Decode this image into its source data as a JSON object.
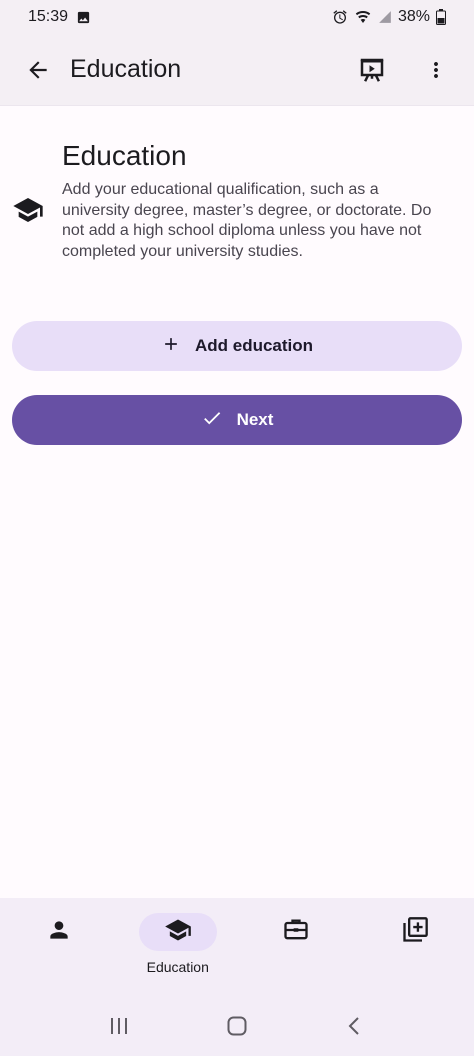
{
  "status_bar": {
    "time": "15:39",
    "battery": "38%"
  },
  "app_bar": {
    "title": "Education",
    "icons": [
      "arrow-back-icon",
      "presentation-icon",
      "more-vert-icon"
    ]
  },
  "intro": {
    "icon": "school-icon",
    "title": "Education",
    "description": "Add your educational qualification, such as a university degree, master’s degree, or doctorate. Do not add a high school diploma unless you have not completed your university studies."
  },
  "buttons": {
    "add_label": "Add education",
    "next_label": "Next"
  },
  "bottom_nav": {
    "items": [
      {
        "icon": "person-icon",
        "label": ""
      },
      {
        "icon": "school-icon",
        "label": "Education",
        "active": true
      },
      {
        "icon": "work-icon",
        "label": ""
      },
      {
        "icon": "library-add-icon",
        "label": ""
      }
    ]
  },
  "colors": {
    "primary": "#6750a4",
    "secondary_container": "#e8def8",
    "surface": "#fffbfe",
    "surface_container": "#f3edf7"
  }
}
